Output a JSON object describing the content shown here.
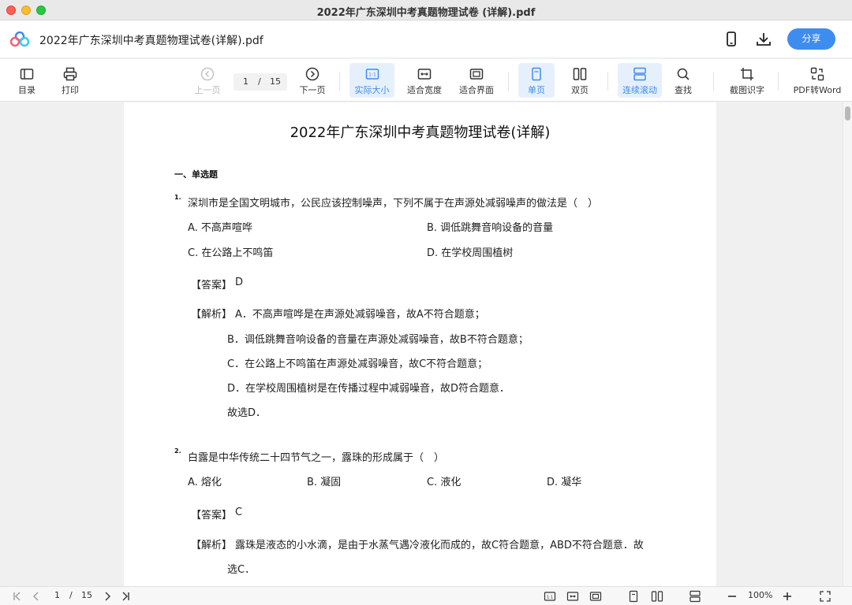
{
  "window": {
    "title": "2022年广东深圳中考真题物理试卷 (详解).pdf"
  },
  "header": {
    "doc_title": "2022年广东深圳中考真题物理试卷(详解).pdf",
    "share_label": "分享"
  },
  "toolbar": {
    "toc": "目录",
    "print": "打印",
    "prev": "上一页",
    "current_page": "1",
    "page_sep": "/",
    "total_pages": "15",
    "next": "下一页",
    "actual_size": "实际大小",
    "fit_width": "适合宽度",
    "fit_page": "适合界面",
    "single_page": "单页",
    "double_page": "双页",
    "continuous": "连续滚动",
    "search": "查找",
    "ocr": "截图识字",
    "pdf_to_word": "PDF转Word"
  },
  "document": {
    "title": "2022年广东深圳中考真题物理试卷(详解)",
    "section": "一、单选题",
    "questions": [
      {
        "num": "1.",
        "stem": "深圳市是全国文明城市，公民应该控制噪声，下列不属于在声源处减弱噪声的做法是（　）",
        "options": [
          "A. 不高声喧哗",
          "B. 调低跳舞音响设备的音量",
          "C. 在公路上不鸣笛",
          "D. 在学校周围植树"
        ],
        "answer_tag": "【答案】",
        "answer": "D",
        "analysis_tag": "【解析】",
        "analysis": [
          "A．不高声喧哗是在声源处减弱噪音，故A不符合题意；",
          "B．调低跳舞音响设备的音量在声源处减弱噪音，故B不符合题意；",
          "C．在公路上不鸣笛在声源处减弱噪音，故C不符合题意；",
          "D．在学校周围植树是在传播过程中减弱噪音，故D符合题意．",
          "故选D．"
        ]
      },
      {
        "num": "2.",
        "stem": "白露是中华传统二十四节气之一，露珠的形成属于（　）",
        "options": [
          "A. 熔化",
          "B. 凝固",
          "C. 液化",
          "D. 凝华"
        ],
        "answer_tag": "【答案】",
        "answer": "C",
        "analysis_tag": "【解析】",
        "analysis": [
          "露珠是液态的小水滴，是由于水蒸气遇冷液化而成的，故C符合题意，ABD不符合题意．故",
          "选C．"
        ]
      }
    ]
  },
  "statusbar": {
    "current_page": "1",
    "page_sep": "/",
    "total_pages": "15",
    "zoom": "100%"
  },
  "colors": {
    "accent": "#3d8cf0",
    "active_bg": "#e6f0fd"
  }
}
